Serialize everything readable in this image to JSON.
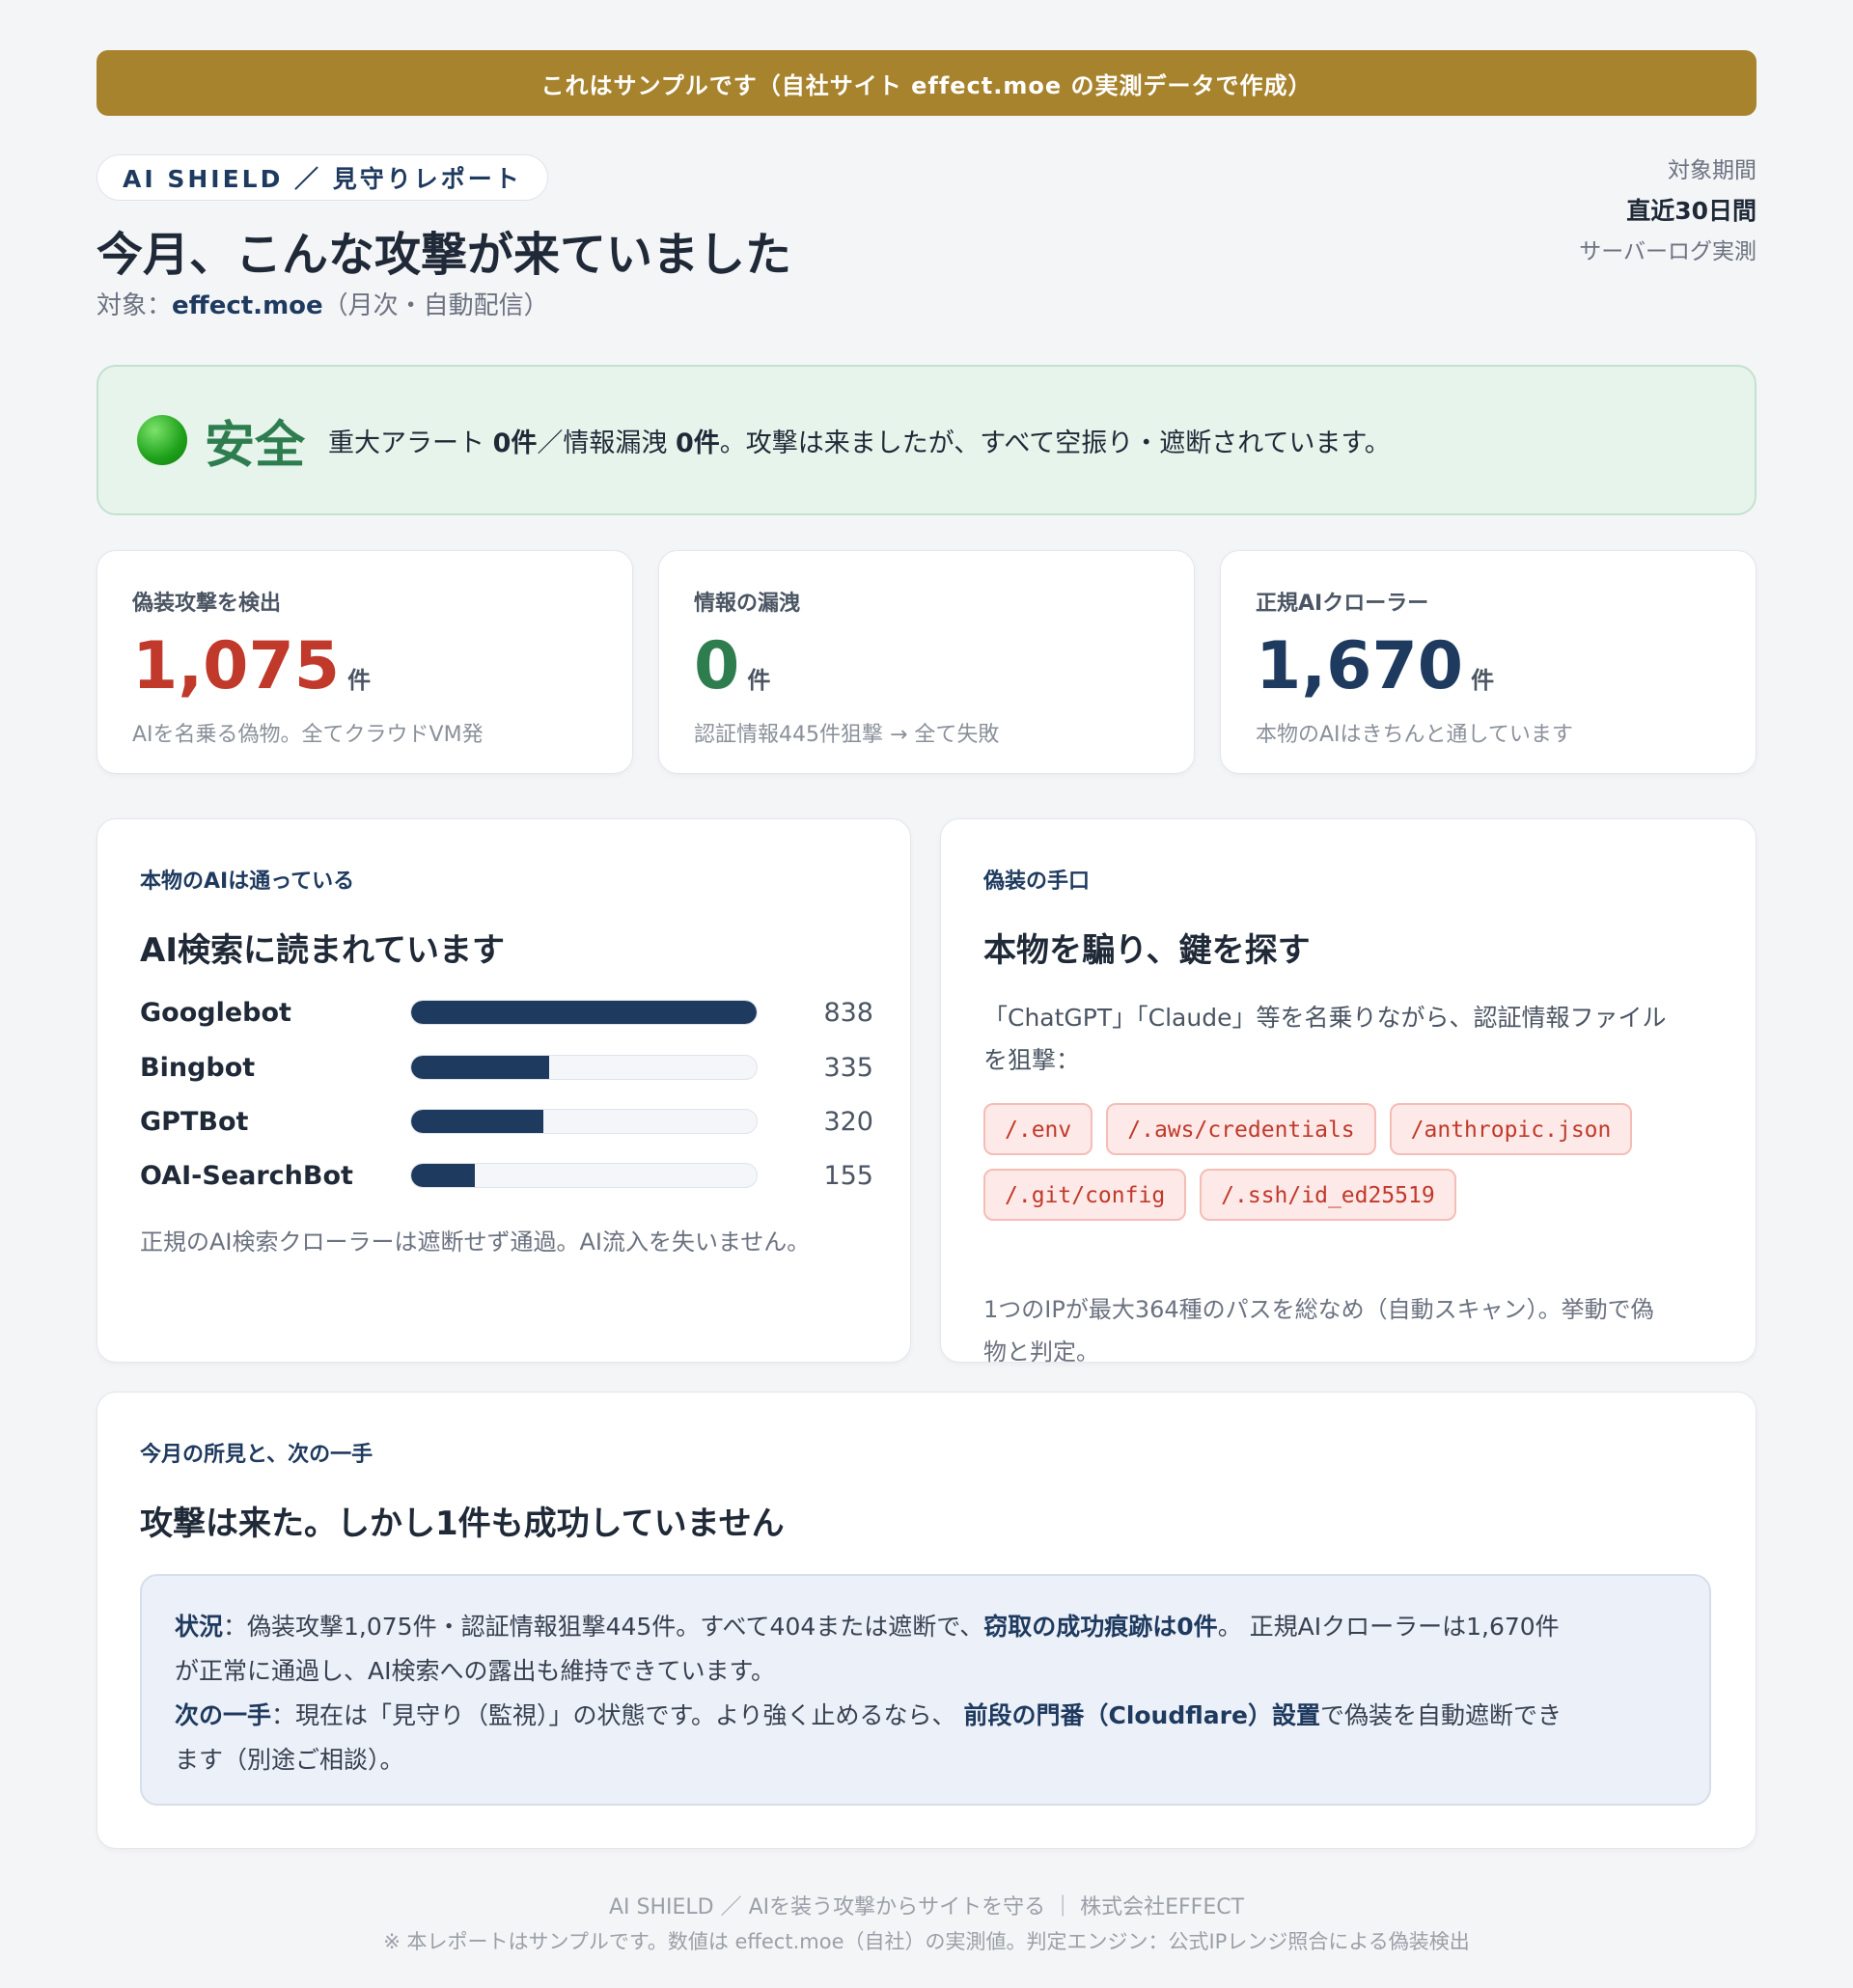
{
  "banner": "これはサンプルです（自社サイト effect.moe の実測データで作成）",
  "header": {
    "pill": "AI SHIELD ／ 見守りレポート",
    "title": "今月、こんな攻撃が来ていました",
    "subtitle_prefix": "対象：",
    "site": "effect.moe",
    "subtitle_suffix": "（月次・自動配信）",
    "period_label": "対象期間",
    "period_value": "直近30日間",
    "period_note": "サーバーログ実測"
  },
  "status": {
    "label": "安全",
    "msg_1": "重大アラート ",
    "alerts": "0件",
    "msg_2": "／情報漏洩 ",
    "leaks": "0件",
    "msg_3": "。攻撃は来ましたが、すべて空振り・遮断されています。",
    "color": "#2e7d4f"
  },
  "metrics": [
    {
      "label": "偽装攻撃を検出",
      "value": "1,075",
      "unit": "件",
      "note": "AIを名乗る偽物。全てクラウドVM発",
      "color": "#c0392b"
    },
    {
      "label": "情報の漏洩",
      "value": "0",
      "unit": "件",
      "note": "認証情報445件狙撃 → 全て失敗",
      "color": "#2e7d4f"
    },
    {
      "label": "正規AIクローラー",
      "value": "1,670",
      "unit": "件",
      "note": "本物のAIはきちんと通しています",
      "color": "#1e3a5f"
    }
  ],
  "crawlers": {
    "kicker": "本物のAIは通っている",
    "title": "AI検索に読まれています",
    "max": 838,
    "items": [
      {
        "name": "Googlebot",
        "value": 838
      },
      {
        "name": "Bingbot",
        "value": 335
      },
      {
        "name": "GPTBot",
        "value": 320
      },
      {
        "name": "OAI-SearchBot",
        "value": 155
      }
    ],
    "note": "正規のAI検索クローラーは遮断せず通過。AI流入を失いません。"
  },
  "spoof": {
    "kicker": "偽装の手口",
    "title": "本物を騙り、鍵を探す",
    "desc_1": "「ChatGPT」「Claude」等を名乗りながら、認証情報ファイル",
    "desc_2": "を狙撃：",
    "tags_row1": [
      "/.env",
      "/.aws/credentials",
      "/anthropic.json"
    ],
    "tags_row2": [
      "/.git/config",
      "/.ssh/id_ed25519"
    ],
    "note_1": "1つのIPが最大364種のパスを総なめ（自動スキャン）。挙動で偽",
    "note_2": "物と判定。"
  },
  "findings": {
    "kicker": "今月の所見と、次の一手",
    "title": "攻撃は来た。しかし1件も成功していません",
    "status_label": "状況",
    "status_text_1": "：偽装攻撃1,075件・認証情報狙撃445件。すべて404または遮断で、",
    "status_bold": "窃取の成功痕跡は0件",
    "status_text_2": "。 正規AIクローラーは1,670件",
    "status_text_3": "が正常に通過し、AI検索への露出も維持できています。",
    "next_label": "次の一手",
    "next_text_1": "：現在は「見守り（監視）」の状態です。より強く止めるなら、 ",
    "next_bold": "前段の門番（Cloudflare）設置",
    "next_text_2": "で偽装を自動遮断でき",
    "next_text_3": "ます（別途ご相談）。"
  },
  "footer": {
    "line1": "AI SHIELD ／ AIを装う攻撃からサイトを守る ｜ 株式会社EFFECT",
    "line2": "※ 本レポートはサンプルです。数値は effect.moe（自社）の実測値。判定エンジン：公式IPレンジ照合による偽装検出"
  }
}
